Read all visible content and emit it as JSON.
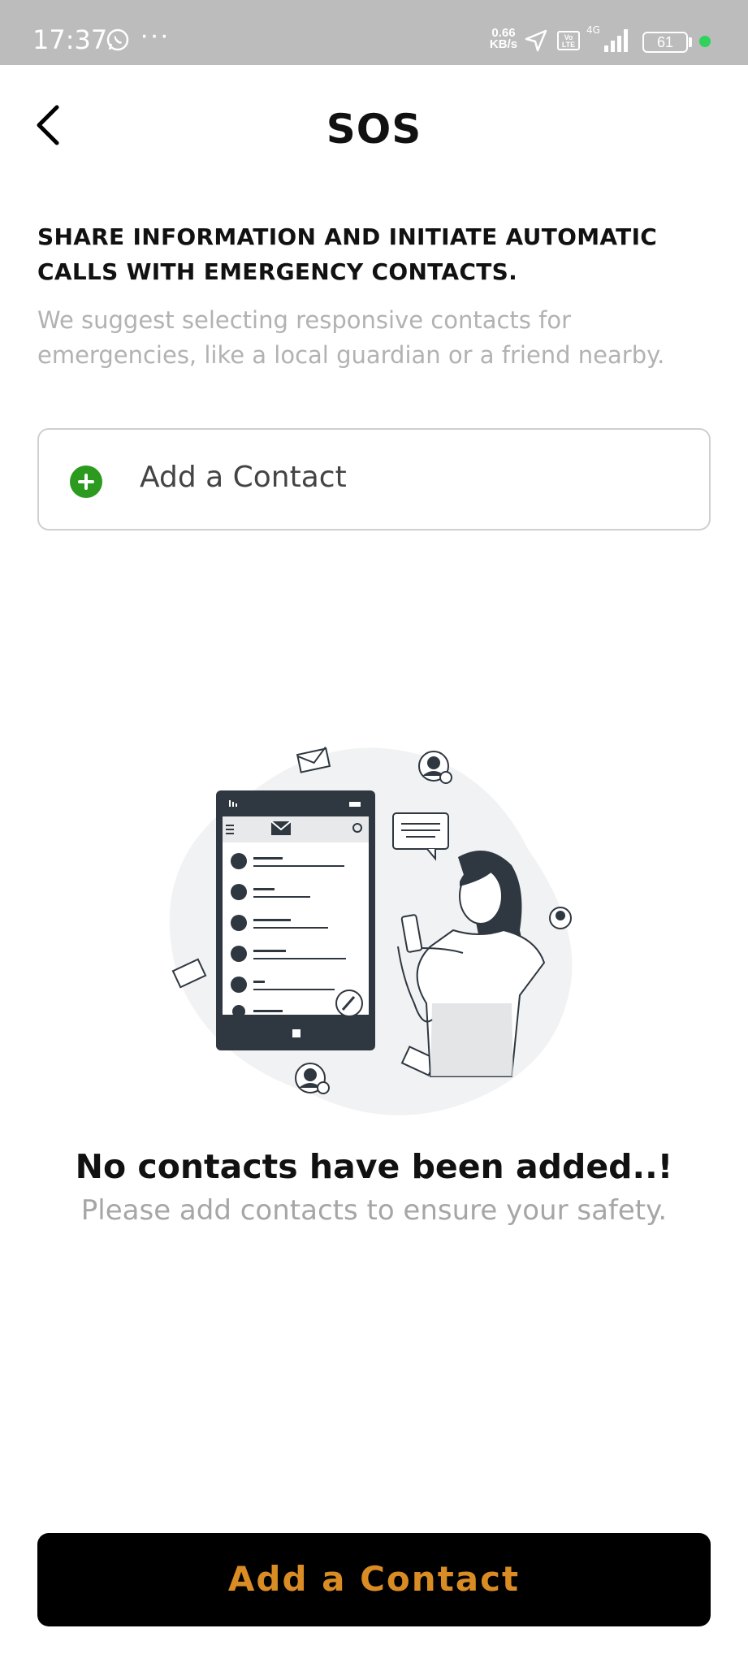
{
  "status_bar": {
    "time": "17:37",
    "overflow": "···",
    "net_speed_value": "0.66",
    "net_speed_unit": "KB/s",
    "volte": "Vo LTE",
    "network": "4G",
    "battery": "61",
    "icons": [
      "whatsapp-icon",
      "location-arrow-icon",
      "volte-icon",
      "signal-icon",
      "battery-icon"
    ]
  },
  "header": {
    "title": "SOS",
    "back_icon": "chevron-left-icon"
  },
  "intro": {
    "heading": "SHARE INFORMATION AND INITIATE AUTOMATIC CALLS WITH EMERGENCY CONTACTS.",
    "description": "We suggest selecting responsive contacts for emergencies, like a local guardian or a friend nearby."
  },
  "add_contact_row": {
    "label": "Add a Contact",
    "icon": "plus-circle-icon"
  },
  "empty_state": {
    "title": "No contacts have been added..!",
    "subtitle": "Please add contacts to ensure your safety."
  },
  "footer": {
    "button_label": "Add a Contact"
  },
  "colors": {
    "status_bar_bg": "#bcbcbc",
    "plus_green": "#2b9a1e",
    "cta_bg": "#000000",
    "cta_text": "#d98b24",
    "muted_text": "#a6a6a6"
  }
}
